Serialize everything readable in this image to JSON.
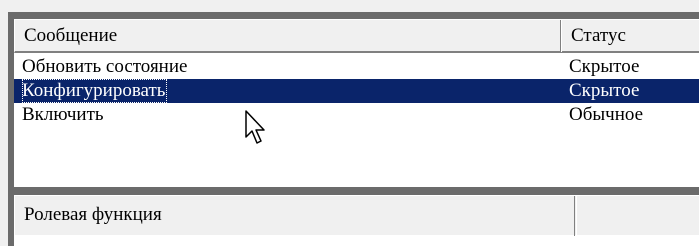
{
  "list": {
    "columns": [
      "Сообщение",
      "Статус"
    ],
    "rows": [
      {
        "message": "Обновить состояние",
        "status": "Скрытое",
        "selected": false
      },
      {
        "message": "Конфигурировать",
        "status": "Скрытое",
        "selected": true
      },
      {
        "message": "Включить",
        "status": "Обычное",
        "selected": false
      }
    ]
  },
  "lower_list": {
    "columns": [
      "Ролевая функция",
      ""
    ]
  },
  "colors": {
    "selection": "#0a246a",
    "panel": "#f0f0f0",
    "border": "#6b6b6b"
  },
  "icons": [
    "mouse-pointer-icon"
  ]
}
